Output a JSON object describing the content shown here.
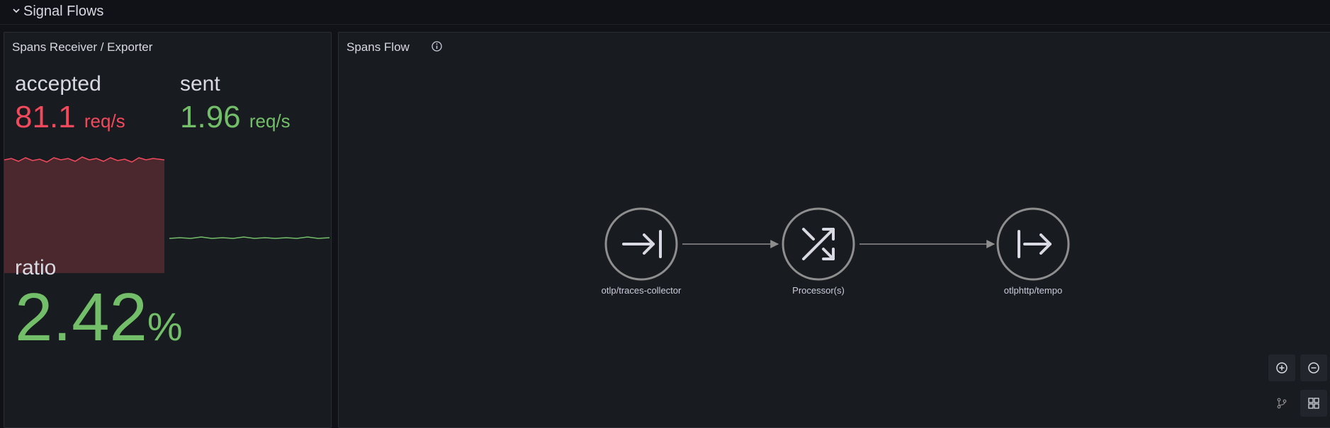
{
  "row": {
    "title": "Signal Flows",
    "icon": "chevron-down-icon"
  },
  "left_panel": {
    "title": "Spans Receiver / Exporter",
    "accepted": {
      "label": "accepted",
      "value": "81.1",
      "unit": "req/s",
      "color": "#f2495c"
    },
    "sent": {
      "label": "sent",
      "value": "1.96",
      "unit": "req/s",
      "color": "#73bf69"
    },
    "ratio": {
      "label": "ratio",
      "value": "2.42",
      "unit": "%",
      "color": "#73bf69"
    }
  },
  "flow_panel": {
    "title": "Spans Flow",
    "info_icon": "info-icon",
    "nodes": [
      {
        "label": "otlp/traces-collector",
        "icon": "arrow-to-bar-icon"
      },
      {
        "label": "Processor(s)",
        "icon": "shuffle-icon"
      },
      {
        "label": "otlphttp/tempo",
        "icon": "arrow-from-bar-icon"
      }
    ],
    "controls": [
      "zoom-in-icon",
      "zoom-out-icon",
      "layout-graph-icon",
      "grid-view-icon"
    ]
  }
}
